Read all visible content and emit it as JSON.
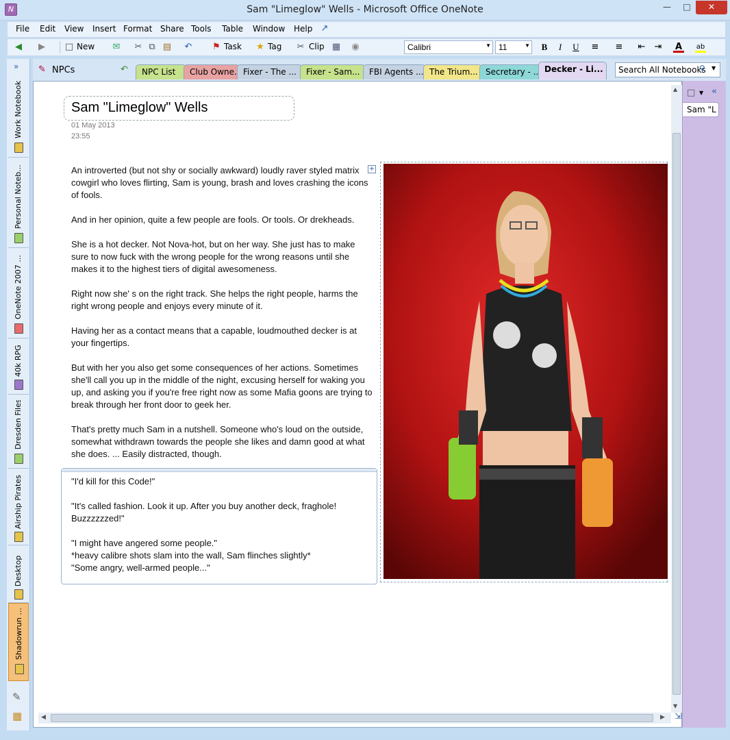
{
  "window": {
    "title": "Sam \"Limeglow\" Wells - Microsoft Office OneNote"
  },
  "menu": [
    "File",
    "Edit",
    "View",
    "Insert",
    "Format",
    "Share",
    "Tools",
    "Table",
    "Window",
    "Help"
  ],
  "toolbar": {
    "new_label": "New",
    "task_label": "Task",
    "tag_label": "Tag",
    "clip_label": "Clip",
    "font_name": "Calibri",
    "font_size": "11"
  },
  "notebooks": [
    "Work Notebook",
    "Personal Noteb...",
    "OneNote 2007 ...",
    "40k RPG",
    "Dresden Files",
    "Airship Pirates",
    "Desktop",
    "Shadowrun ..."
  ],
  "section_group": "NPCs",
  "tabs": [
    "NPC List",
    "Club Owne...",
    "Fixer - The ...",
    "Fixer - Sam...",
    "FBI Agents ...",
    "The Trium...",
    "Secretary - ...",
    "Decker - Li..."
  ],
  "search": {
    "placeholder": "Search All Notebooks"
  },
  "page": {
    "title": "Sam \"Limeglow\" Wells",
    "date": "01 May 2013",
    "time": "23:55",
    "paragraphs": [
      "An introverted (but not shy or socially awkward) loudly raver styled matrix cowgirl who loves flirting, Sam is young, brash and loves crashing the icons of fools.",
      "And in her opinion, quite a few people are fools. Or tools. Or drekheads.",
      "She is a hot decker. Not Nova-hot, but on her way. She just has to make sure to now fuck with the wrong people for the wrong reasons until she makes it to the highest tiers of digital awesomeness.",
      "Right now she' s on the right track. She helps the right people, harms the right wrong people and enjoys every minute of it.",
      "Having her as a contact means that a capable, loudmouthed decker is at your fingertips.",
      "But with her you also get some consequences of her actions. Sometimes she'll call you up in the middle of the night, excusing herself for waking you up, and asking you if you're free right now as some Mafia goons are trying to break through her front door to geek her.",
      "That's pretty much Sam in a nutshell. Someone who's loud on the outside, somewhat withdrawn towards the people she likes and damn good at what she does. ... Easily distracted, though."
    ],
    "quotes": [
      "\"I'd kill for this Code!\"",
      "\"It's called fashion. Look it up. After you buy another deck, fraghole! Buzzzzzzed!\"",
      "\"I might have angered some people.\"",
      "*heavy calibre shots slam into the wall, Sam flinches slightly*",
      "\"Some angry, well-armed people...\""
    ]
  },
  "page_tabs": [
    "Sam \"L"
  ],
  "colors": {
    "accent": "#cdbde5",
    "close": "#c7362b"
  }
}
